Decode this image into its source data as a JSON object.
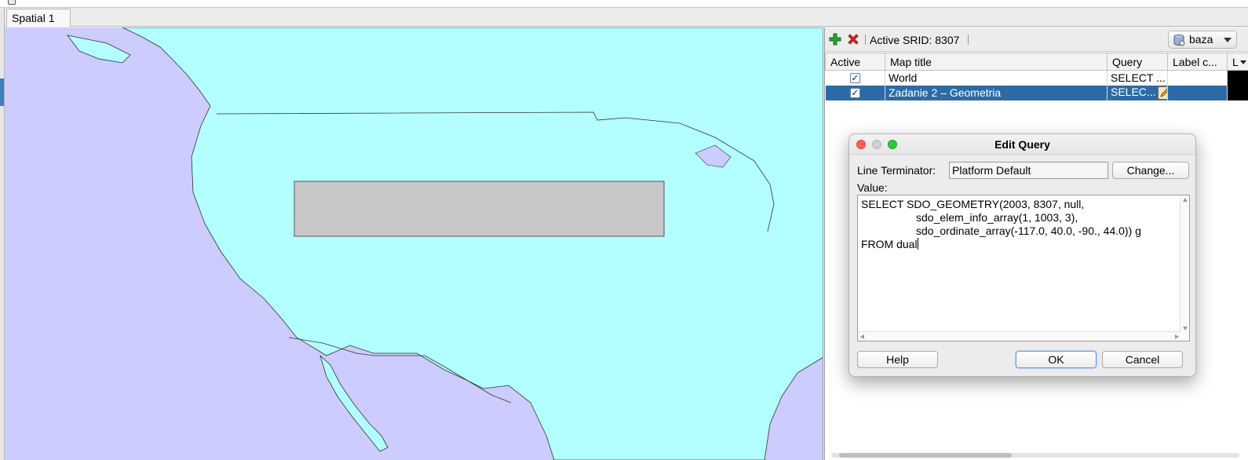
{
  "tab": {
    "label": "Spatial 1"
  },
  "panel": {
    "active_srid": "Active SRID: 8307",
    "connection": {
      "label": "baza",
      "icon": "database-icon"
    },
    "columns": [
      "Active",
      "Map title",
      "Query",
      "Label c...",
      "L"
    ],
    "layers": [
      {
        "active": "✓",
        "title": "World",
        "query": "SELECT ...",
        "color": "#000000"
      },
      {
        "active": "✓",
        "title": "Zadanie 2 – Geometria",
        "query": "SELEC...",
        "color": "#000000",
        "selected": true
      }
    ],
    "toolbar_icons": [
      "add-layer-icon",
      "remove-layer-icon"
    ]
  },
  "dialog": {
    "title": "Edit Query",
    "line_terminator_label": "Line Terminator:",
    "line_terminator_value": "Platform Default",
    "change_button": "Change...",
    "value_label": "Value:",
    "query_lines": [
      "SELECT SDO_GEOMETRY(2003, 8307, null,",
      "                  sdo_elem_info_array(1, 1003, 3),",
      "                  sdo_ordinate_array(-117.0, 40.0, -90., 44.0)) g",
      "FROM dual"
    ],
    "help_button": "Help",
    "ok_button": "OK",
    "cancel_button": "Cancel"
  },
  "colors": {
    "land": "#b3ffff",
    "ocean": "#ccccff",
    "query_geometry": "#c8c8c8",
    "selection": "#2c6ba5"
  }
}
